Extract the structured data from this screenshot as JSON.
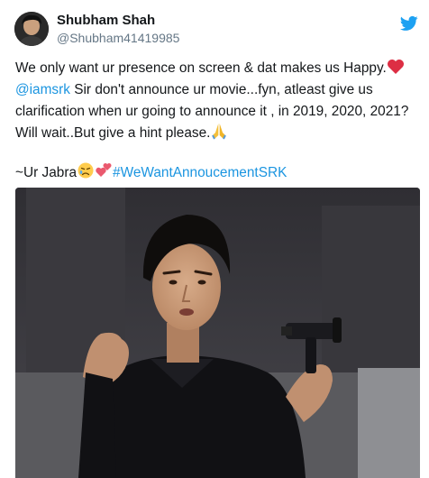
{
  "user": {
    "display_name": "Shubham Shah",
    "handle": "@Shubham41419985"
  },
  "tweet": {
    "line1": "We only want ur presence on screen & dat makes us Happy.",
    "mention": "@iamsrk",
    "line2_rest": " Sir don't announce ur movie...fyn, atleast give us",
    "line3": "clarification when ur going to announce it , in 2019, 2020, 2021?",
    "line4": " Will wait..But give a hint please.",
    "signoff": "~Ur Jabra",
    "hashtag": "#WeWantAnnoucementSRK"
  },
  "icons": {
    "platform": "twitter-bird-icon",
    "emojis": [
      "red-heart-icon",
      "folded-hands-icon",
      "sad-face-icon",
      "two-hearts-icon"
    ]
  },
  "colors": {
    "link": "#1b95e0",
    "text": "#14171a",
    "secondary": "#657786"
  }
}
